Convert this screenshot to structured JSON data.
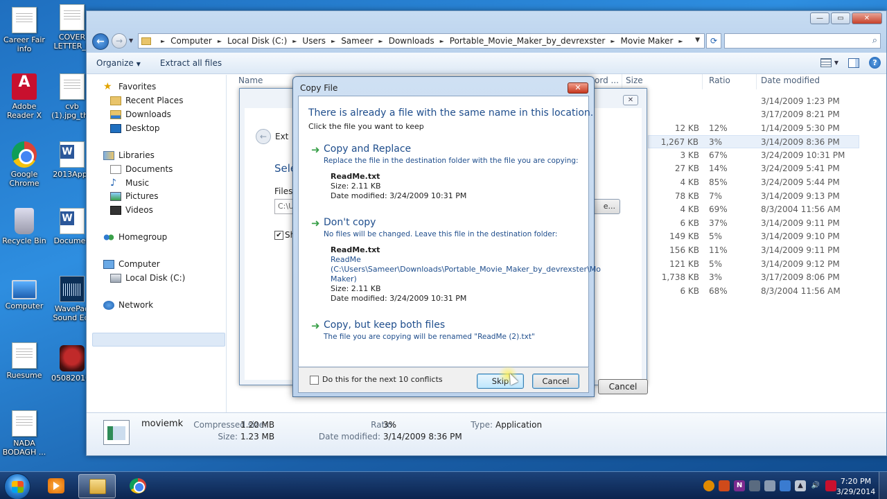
{
  "desktop": {
    "icons": [
      {
        "label": "Career Fair info",
        "icon": "document-icon"
      },
      {
        "label": "COVER LETTER_P",
        "icon": "document-icon"
      },
      {
        "label": "Adobe Reader X",
        "icon": "adobe-reader-icon"
      },
      {
        "label": "cvb (1).jpg_thu",
        "icon": "document-icon"
      },
      {
        "label": "Google Chrome",
        "icon": "chrome-icon"
      },
      {
        "label": "2013Appli",
        "icon": "word-document-icon"
      },
      {
        "label": "Recycle Bin",
        "icon": "recycle-bin-icon"
      },
      {
        "label": "Documen",
        "icon": "word-document-icon"
      },
      {
        "label": "Computer",
        "icon": "computer-icon"
      },
      {
        "label": "WavePad Sound Edi",
        "icon": "wavepad-icon"
      },
      {
        "label": "Ruesume",
        "icon": "document-icon"
      },
      {
        "label": "05082010-",
        "icon": "photo-icon"
      },
      {
        "label": "NADA BODAGH ...",
        "icon": "document-icon"
      }
    ]
  },
  "explorer": {
    "address": [
      "Computer",
      "Local Disk (C:)",
      "Users",
      "Sameer",
      "Downloads",
      "Portable_Movie_Maker_by_devrexster",
      "Movie Maker"
    ],
    "toolbar": {
      "organize": "Organize",
      "extract_all": "Extract all files"
    },
    "nav": {
      "favorites": "Favorites",
      "recent_places": "Recent Places",
      "downloads": "Downloads",
      "desktop": "Desktop",
      "libraries": "Libraries",
      "documents": "Documents",
      "music": "Music",
      "pictures": "Pictures",
      "videos": "Videos",
      "homegroup": "Homegroup",
      "computer": "Computer",
      "local_disk": "Local Disk (C:)",
      "network": "Network"
    },
    "columns": {
      "name": "Name",
      "compressed": "ord ...",
      "size": "Size",
      "ratio": "Ratio",
      "date": "Date modified"
    },
    "rows": [
      {
        "size": "",
        "ratio": "",
        "date": "3/14/2009 1:23 PM"
      },
      {
        "size": "",
        "ratio": "",
        "date": "3/17/2009 8:21 PM"
      },
      {
        "size": "12 KB",
        "ratio": "12%",
        "date": "1/14/2009 5:30 PM"
      },
      {
        "size": "1,267 KB",
        "ratio": "3%",
        "date": "3/14/2009 8:36 PM"
      },
      {
        "size": "3 KB",
        "ratio": "67%",
        "date": "3/24/2009 10:31 PM"
      },
      {
        "size": "27 KB",
        "ratio": "14%",
        "date": "3/24/2009 5:41 PM"
      },
      {
        "size": "4 KB",
        "ratio": "85%",
        "date": "3/24/2009 5:44 PM"
      },
      {
        "size": "78 KB",
        "ratio": "7%",
        "date": "3/14/2009 9:13 PM"
      },
      {
        "size": "4 KB",
        "ratio": "69%",
        "date": "8/3/2004 11:56 AM"
      },
      {
        "size": "6 KB",
        "ratio": "37%",
        "date": "3/14/2009 9:11 PM"
      },
      {
        "size": "149 KB",
        "ratio": "5%",
        "date": "3/14/2009 9:10 PM"
      },
      {
        "size": "156 KB",
        "ratio": "11%",
        "date": "3/14/2009 9:11 PM"
      },
      {
        "size": "121 KB",
        "ratio": "5%",
        "date": "3/14/2009 9:12 PM"
      },
      {
        "size": "1,738 KB",
        "ratio": "3%",
        "date": "3/17/2009 8:06 PM"
      },
      {
        "size": "6 KB",
        "ratio": "68%",
        "date": "8/3/2004 11:56 AM"
      }
    ],
    "details": {
      "name": "moviemk",
      "compressed_label": "Compressed size:",
      "compressed_value": "1.20 MB",
      "size_label": "Size:",
      "size_value": "1.23 MB",
      "ratio_label": "Ratio:",
      "ratio_value": "3%",
      "date_label": "Date modified:",
      "date_value": "3/14/2009 8:36 PM",
      "type_label": "Type:",
      "type_value": "Application"
    }
  },
  "extract_dialog": {
    "title": "Ext",
    "heading": "Selec",
    "files_label": "Files w",
    "path_value": "C:\\Us",
    "browse": "e...",
    "show_label": "Sho",
    "cancel": "Cancel"
  },
  "copy_dialog": {
    "title": "Copy File",
    "heading": "There is already a file with the same name in this location.",
    "subheading": "Click the file you want to keep",
    "option_replace": {
      "title": "Copy and Replace",
      "desc": "Replace the file in the destination folder with the file you are copying:",
      "file_name": "ReadMe.txt",
      "size": "Size: 2.11 KB",
      "date": "Date modified: 3/24/2009 10:31 PM"
    },
    "option_dont_copy": {
      "title": "Don't copy",
      "desc": "No files will be changed. Leave this file in the destination folder:",
      "file_name": "ReadMe.txt",
      "link_1": "ReadMe",
      "link_2": "(C:\\Users\\Sameer\\Downloads\\Portable_Movie_Maker_by_devrexster\\Mo",
      "link_3": "Maker)",
      "size": "Size: 2.11 KB",
      "date": "Date modified: 3/24/2009 10:31 PM"
    },
    "option_keep_both": {
      "title": "Copy, but keep both files",
      "desc": "The file you are copying will be renamed \"ReadMe (2).txt\""
    },
    "checkbox_label": "Do this for the next 10 conflicts",
    "checkbox_checked": false,
    "skip": "Skip",
    "cancel": "Cancel"
  },
  "taskbar": {
    "time": "7:20 PM",
    "date": "3/29/2014"
  },
  "colors": {
    "accent_blue": "#1e4d8c",
    "arrow_green": "#3aa04a",
    "close_red": "#c6381f"
  }
}
